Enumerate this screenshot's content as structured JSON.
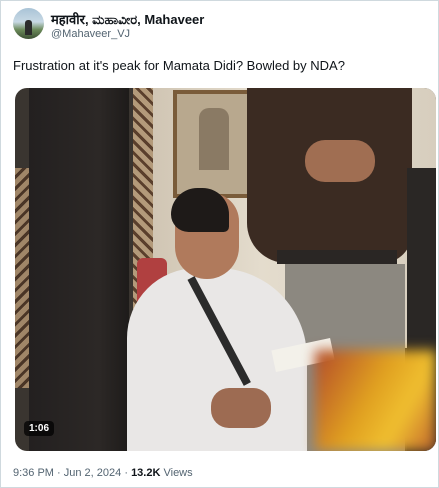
{
  "tweet": {
    "author_name": "महावीर, ಮಹಾವೀರ, Mahaveer",
    "handle": "@Mahaveer_VJ",
    "text": "Frustration at it's peak for Mamata Didi? Bowled by NDA?",
    "time": "9:36 PM",
    "separator": "·",
    "date": "Jun 2, 2024",
    "views_count": "13.2K",
    "views_label": "Views"
  },
  "media": {
    "type": "video",
    "duration": "1:06"
  },
  "icons": {
    "avatar": "profile-avatar-icon"
  }
}
